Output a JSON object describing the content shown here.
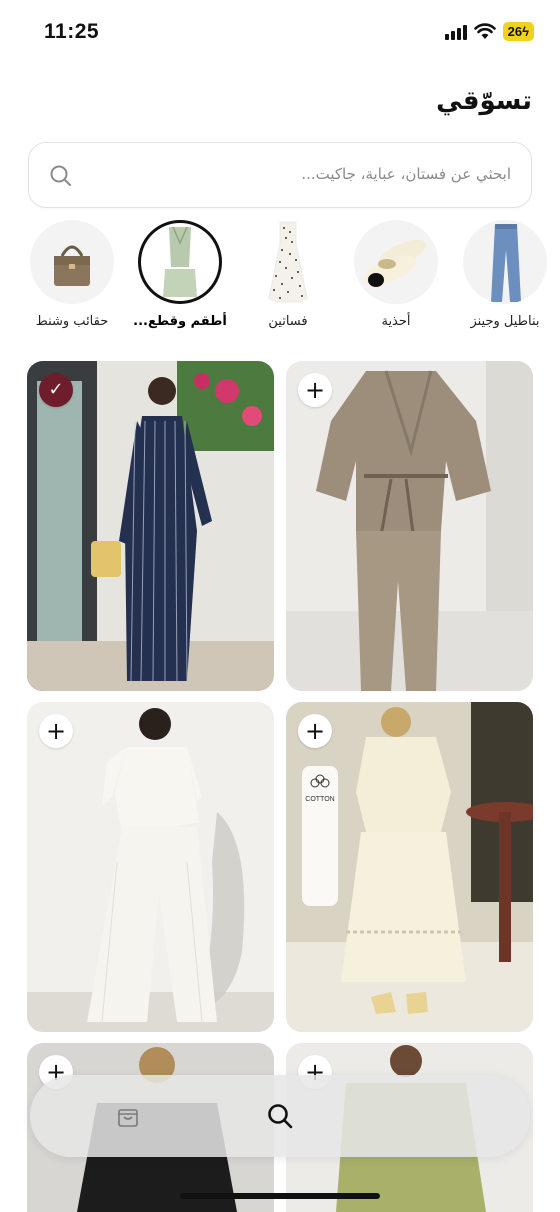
{
  "status_bar": {
    "time": "11:25",
    "battery": "26"
  },
  "header": {
    "title": "تسوّقي"
  },
  "search": {
    "placeholder": "ابحثي عن فستان، عباية، جاكيت..."
  },
  "categories": [
    {
      "label": "بناطيل وجينز",
      "icon": "jeans-icon",
      "active": false
    },
    {
      "label": "أحذية",
      "icon": "shoes-icon",
      "active": false
    },
    {
      "label": "فساتين",
      "icon": "dress-icon",
      "active": false
    },
    {
      "label": "أطقم وقطع...",
      "icon": "outfit-set-icon",
      "active": true
    },
    {
      "label": "حقائب وشنط",
      "icon": "handbag-icon",
      "active": false
    }
  ],
  "products": [
    {
      "name": "navy-striped-set",
      "state": "selected",
      "button": "✓"
    },
    {
      "name": "beige-wrap-set",
      "state": "add",
      "button": "+"
    },
    {
      "name": "white-wide-leg-set",
      "state": "add",
      "button": "+"
    },
    {
      "name": "cream-cotton-set",
      "state": "add",
      "button": "+",
      "badge": "COTTON"
    },
    {
      "name": "black-outfit",
      "state": "add",
      "button": "+"
    },
    {
      "name": "olive-outfit",
      "state": "add",
      "button": "+"
    }
  ],
  "colors": {
    "accent_selected": "#6e1d2c",
    "battery": "#f0d11d"
  }
}
